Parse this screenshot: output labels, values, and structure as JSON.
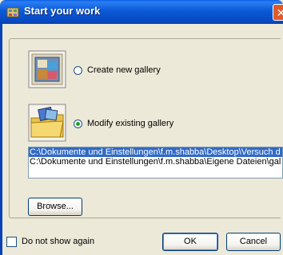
{
  "window": {
    "title": "Start your work",
    "close_glyph": "✕"
  },
  "options": {
    "create_label": "Create new gallery",
    "modify_label": "Modify existing gallery",
    "selected": "modify"
  },
  "recent": {
    "items": [
      {
        "path": "C:\\Dokumente und Einstellungen\\f.m.shabba\\Desktop\\Versuch d",
        "selected": true
      },
      {
        "path": "C:\\Dokumente und Einstellungen\\f.m.shabba\\Eigene Dateien\\gal",
        "selected": false
      }
    ]
  },
  "buttons": {
    "browse": "Browse...",
    "ok": "OK",
    "cancel": "Cancel"
  },
  "footer": {
    "do_not_show": "Do not show again",
    "checked": false
  },
  "colors": {
    "titlebar": "#0a59d6",
    "selection": "#316ac5",
    "face": "#ece9d8"
  },
  "icons": {
    "title": "gallery-app-icon",
    "create": "new-gallery-icon",
    "modify": "open-folder-gallery-icon"
  }
}
